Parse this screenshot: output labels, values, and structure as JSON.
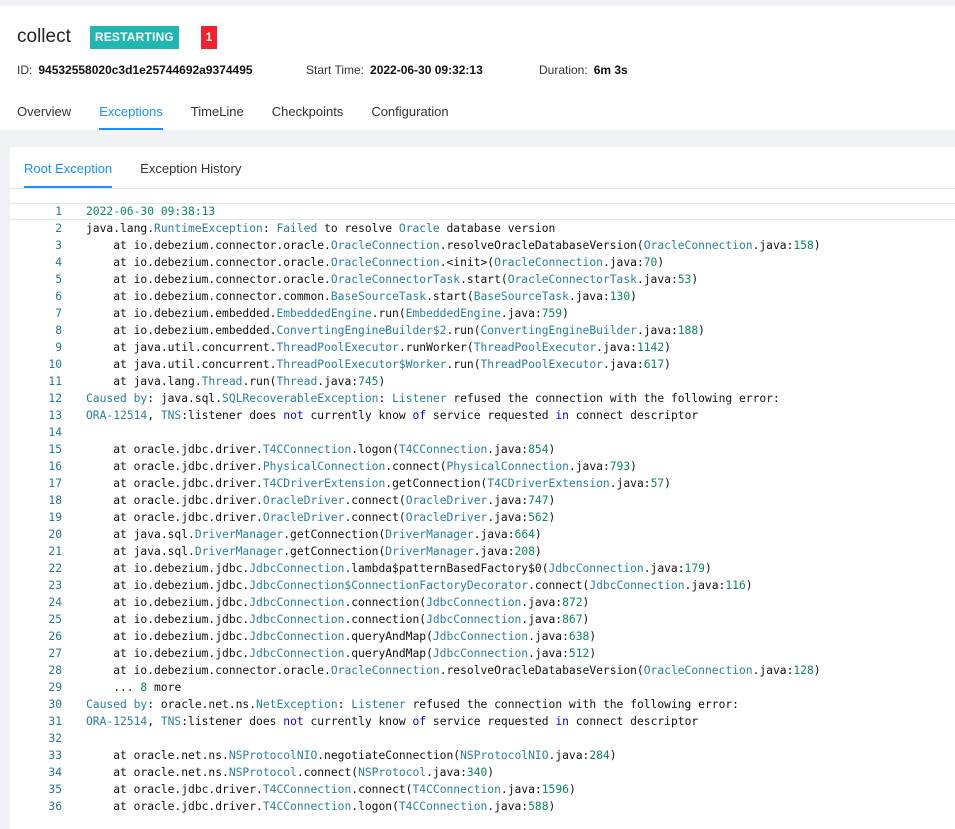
{
  "job": {
    "name": "collect",
    "status": "RESTARTING",
    "exception_count": "1",
    "id_label": "ID:",
    "id_value": "94532558020c3d1e25744692a9374495",
    "start_label": "Start Time:",
    "start_value": "2022-06-30 09:32:13",
    "duration_label": "Duration:",
    "duration_value": "6m 3s"
  },
  "tabs": [
    "Overview",
    "Exceptions",
    "TimeLine",
    "Checkpoints",
    "Configuration"
  ],
  "active_tab": "Exceptions",
  "subtabs": [
    "Root Exception",
    "Exception History"
  ],
  "active_subtab": "Root Exception",
  "colors": {
    "accent": "#1890ff",
    "status_badge": "#1fb7b2",
    "count_badge": "#f5222d",
    "line_number": "#237893",
    "class_token": "#2a7f9e",
    "number_token": "#09885a",
    "keyword_token": "#0000ff"
  },
  "code_lines": [
    [
      [
        "d",
        "2022-06-30 09:38:13"
      ]
    ],
    [
      [
        "p",
        "java.lang."
      ],
      [
        "k",
        "RuntimeException"
      ],
      [
        "p",
        ": "
      ],
      [
        "k",
        "Failed"
      ],
      [
        "p",
        " to resolve "
      ],
      [
        "k",
        "Oracle"
      ],
      [
        "p",
        " database version"
      ]
    ],
    [
      [
        "p",
        "    at io.debezium.connector.oracle."
      ],
      [
        "k",
        "OracleConnection"
      ],
      [
        "p",
        ".resolveOracleDatabaseVersion("
      ],
      [
        "k",
        "OracleConnection"
      ],
      [
        "p",
        ".java:"
      ],
      [
        "n",
        "158"
      ],
      [
        "p",
        ")"
      ]
    ],
    [
      [
        "p",
        "    at io.debezium.connector.oracle."
      ],
      [
        "k",
        "OracleConnection"
      ],
      [
        "p",
        ".<init>("
      ],
      [
        "k",
        "OracleConnection"
      ],
      [
        "p",
        ".java:"
      ],
      [
        "n",
        "70"
      ],
      [
        "p",
        ")"
      ]
    ],
    [
      [
        "p",
        "    at io.debezium.connector.oracle."
      ],
      [
        "k",
        "OracleConnectorTask"
      ],
      [
        "p",
        ".start("
      ],
      [
        "k",
        "OracleConnectorTask"
      ],
      [
        "p",
        ".java:"
      ],
      [
        "n",
        "53"
      ],
      [
        "p",
        ")"
      ]
    ],
    [
      [
        "p",
        "    at io.debezium.connector.common."
      ],
      [
        "k",
        "BaseSourceTask"
      ],
      [
        "p",
        ".start("
      ],
      [
        "k",
        "BaseSourceTask"
      ],
      [
        "p",
        ".java:"
      ],
      [
        "n",
        "130"
      ],
      [
        "p",
        ")"
      ]
    ],
    [
      [
        "p",
        "    at io.debezium.embedded."
      ],
      [
        "k",
        "EmbeddedEngine"
      ],
      [
        "p",
        ".run("
      ],
      [
        "k",
        "EmbeddedEngine"
      ],
      [
        "p",
        ".java:"
      ],
      [
        "n",
        "759"
      ],
      [
        "p",
        ")"
      ]
    ],
    [
      [
        "p",
        "    at io.debezium.embedded."
      ],
      [
        "k",
        "ConvertingEngineBuilder$2"
      ],
      [
        "p",
        ".run("
      ],
      [
        "k",
        "ConvertingEngineBuilder"
      ],
      [
        "p",
        ".java:"
      ],
      [
        "n",
        "188"
      ],
      [
        "p",
        ")"
      ]
    ],
    [
      [
        "p",
        "    at java.util.concurrent."
      ],
      [
        "k",
        "ThreadPoolExecutor"
      ],
      [
        "p",
        ".runWorker("
      ],
      [
        "k",
        "ThreadPoolExecutor"
      ],
      [
        "p",
        ".java:"
      ],
      [
        "n",
        "1142"
      ],
      [
        "p",
        ")"
      ]
    ],
    [
      [
        "p",
        "    at java.util.concurrent."
      ],
      [
        "k",
        "ThreadPoolExecutor$Worker"
      ],
      [
        "p",
        ".run("
      ],
      [
        "k",
        "ThreadPoolExecutor"
      ],
      [
        "p",
        ".java:"
      ],
      [
        "n",
        "617"
      ],
      [
        "p",
        ")"
      ]
    ],
    [
      [
        "p",
        "    at java.lang."
      ],
      [
        "k",
        "Thread"
      ],
      [
        "p",
        ".run("
      ],
      [
        "k",
        "Thread"
      ],
      [
        "p",
        ".java:"
      ],
      [
        "n",
        "745"
      ],
      [
        "p",
        ")"
      ]
    ],
    [
      [
        "k",
        "Caused by"
      ],
      [
        "p",
        ": java.sql."
      ],
      [
        "k",
        "SQLRecoverableException"
      ],
      [
        "p",
        ": "
      ],
      [
        "k",
        "Listener"
      ],
      [
        "p",
        " refused the connection with the following error:"
      ]
    ],
    [
      [
        "k",
        "ORA-12514"
      ],
      [
        "p",
        ", "
      ],
      [
        "k",
        "TNS"
      ],
      [
        "p",
        ":listener does "
      ],
      [
        "b",
        "not"
      ],
      [
        "p",
        " currently know "
      ],
      [
        "b",
        "of"
      ],
      [
        "p",
        " service requested "
      ],
      [
        "b",
        "in"
      ],
      [
        "p",
        " connect descriptor"
      ]
    ],
    [
      [
        "p",
        ""
      ]
    ],
    [
      [
        "p",
        "    at oracle.jdbc.driver."
      ],
      [
        "k",
        "T4CConnection"
      ],
      [
        "p",
        ".logon("
      ],
      [
        "k",
        "T4CConnection"
      ],
      [
        "p",
        ".java:"
      ],
      [
        "n",
        "854"
      ],
      [
        "p",
        ")"
      ]
    ],
    [
      [
        "p",
        "    at oracle.jdbc.driver."
      ],
      [
        "k",
        "PhysicalConnection"
      ],
      [
        "p",
        ".connect("
      ],
      [
        "k",
        "PhysicalConnection"
      ],
      [
        "p",
        ".java:"
      ],
      [
        "n",
        "793"
      ],
      [
        "p",
        ")"
      ]
    ],
    [
      [
        "p",
        "    at oracle.jdbc.driver."
      ],
      [
        "k",
        "T4CDriverExtension"
      ],
      [
        "p",
        ".getConnection("
      ],
      [
        "k",
        "T4CDriverExtension"
      ],
      [
        "p",
        ".java:"
      ],
      [
        "n",
        "57"
      ],
      [
        "p",
        ")"
      ]
    ],
    [
      [
        "p",
        "    at oracle.jdbc.driver."
      ],
      [
        "k",
        "OracleDriver"
      ],
      [
        "p",
        ".connect("
      ],
      [
        "k",
        "OracleDriver"
      ],
      [
        "p",
        ".java:"
      ],
      [
        "n",
        "747"
      ],
      [
        "p",
        ")"
      ]
    ],
    [
      [
        "p",
        "    at oracle.jdbc.driver."
      ],
      [
        "k",
        "OracleDriver"
      ],
      [
        "p",
        ".connect("
      ],
      [
        "k",
        "OracleDriver"
      ],
      [
        "p",
        ".java:"
      ],
      [
        "n",
        "562"
      ],
      [
        "p",
        ")"
      ]
    ],
    [
      [
        "p",
        "    at java.sql."
      ],
      [
        "k",
        "DriverManager"
      ],
      [
        "p",
        ".getConnection("
      ],
      [
        "k",
        "DriverManager"
      ],
      [
        "p",
        ".java:"
      ],
      [
        "n",
        "664"
      ],
      [
        "p",
        ")"
      ]
    ],
    [
      [
        "p",
        "    at java.sql."
      ],
      [
        "k",
        "DriverManager"
      ],
      [
        "p",
        ".getConnection("
      ],
      [
        "k",
        "DriverManager"
      ],
      [
        "p",
        ".java:"
      ],
      [
        "n",
        "208"
      ],
      [
        "p",
        ")"
      ]
    ],
    [
      [
        "p",
        "    at io.debezium.jdbc."
      ],
      [
        "k",
        "JdbcConnection"
      ],
      [
        "p",
        ".lambda$patternBasedFactory$0("
      ],
      [
        "k",
        "JdbcConnection"
      ],
      [
        "p",
        ".java:"
      ],
      [
        "n",
        "179"
      ],
      [
        "p",
        ")"
      ]
    ],
    [
      [
        "p",
        "    at io.debezium.jdbc."
      ],
      [
        "k",
        "JdbcConnection$ConnectionFactoryDecorator"
      ],
      [
        "p",
        ".connect("
      ],
      [
        "k",
        "JdbcConnection"
      ],
      [
        "p",
        ".java:"
      ],
      [
        "n",
        "116"
      ],
      [
        "p",
        ")"
      ]
    ],
    [
      [
        "p",
        "    at io.debezium.jdbc."
      ],
      [
        "k",
        "JdbcConnection"
      ],
      [
        "p",
        ".connection("
      ],
      [
        "k",
        "JdbcConnection"
      ],
      [
        "p",
        ".java:"
      ],
      [
        "n",
        "872"
      ],
      [
        "p",
        ")"
      ]
    ],
    [
      [
        "p",
        "    at io.debezium.jdbc."
      ],
      [
        "k",
        "JdbcConnection"
      ],
      [
        "p",
        ".connection("
      ],
      [
        "k",
        "JdbcConnection"
      ],
      [
        "p",
        ".java:"
      ],
      [
        "n",
        "867"
      ],
      [
        "p",
        ")"
      ]
    ],
    [
      [
        "p",
        "    at io.debezium.jdbc."
      ],
      [
        "k",
        "JdbcConnection"
      ],
      [
        "p",
        ".queryAndMap("
      ],
      [
        "k",
        "JdbcConnection"
      ],
      [
        "p",
        ".java:"
      ],
      [
        "n",
        "638"
      ],
      [
        "p",
        ")"
      ]
    ],
    [
      [
        "p",
        "    at io.debezium.jdbc."
      ],
      [
        "k",
        "JdbcConnection"
      ],
      [
        "p",
        ".queryAndMap("
      ],
      [
        "k",
        "JdbcConnection"
      ],
      [
        "p",
        ".java:"
      ],
      [
        "n",
        "512"
      ],
      [
        "p",
        ")"
      ]
    ],
    [
      [
        "p",
        "    at io.debezium.connector.oracle."
      ],
      [
        "k",
        "OracleConnection"
      ],
      [
        "p",
        ".resolveOracleDatabaseVersion("
      ],
      [
        "k",
        "OracleConnection"
      ],
      [
        "p",
        ".java:"
      ],
      [
        "n",
        "128"
      ],
      [
        "p",
        ")"
      ]
    ],
    [
      [
        "p",
        "    ... "
      ],
      [
        "n",
        "8"
      ],
      [
        "p",
        " more"
      ]
    ],
    [
      [
        "k",
        "Caused by"
      ],
      [
        "p",
        ": oracle.net.ns."
      ],
      [
        "k",
        "NetException"
      ],
      [
        "p",
        ": "
      ],
      [
        "k",
        "Listener"
      ],
      [
        "p",
        " refused the connection with the following error:"
      ]
    ],
    [
      [
        "k",
        "ORA-12514"
      ],
      [
        "p",
        ", "
      ],
      [
        "k",
        "TNS"
      ],
      [
        "p",
        ":listener does "
      ],
      [
        "b",
        "not"
      ],
      [
        "p",
        " currently know "
      ],
      [
        "b",
        "of"
      ],
      [
        "p",
        " service requested "
      ],
      [
        "b",
        "in"
      ],
      [
        "p",
        " connect descriptor"
      ]
    ],
    [
      [
        "p",
        ""
      ]
    ],
    [
      [
        "p",
        "    at oracle.net.ns."
      ],
      [
        "k",
        "NSProtocolNIO"
      ],
      [
        "p",
        ".negotiateConnection("
      ],
      [
        "k",
        "NSProtocolNIO"
      ],
      [
        "p",
        ".java:"
      ],
      [
        "n",
        "284"
      ],
      [
        "p",
        ")"
      ]
    ],
    [
      [
        "p",
        "    at oracle.net.ns."
      ],
      [
        "k",
        "NSProtocol"
      ],
      [
        "p",
        ".connect("
      ],
      [
        "k",
        "NSProtocol"
      ],
      [
        "p",
        ".java:"
      ],
      [
        "n",
        "340"
      ],
      [
        "p",
        ")"
      ]
    ],
    [
      [
        "p",
        "    at oracle.jdbc.driver."
      ],
      [
        "k",
        "T4CConnection"
      ],
      [
        "p",
        ".connect("
      ],
      [
        "k",
        "T4CConnection"
      ],
      [
        "p",
        ".java:"
      ],
      [
        "n",
        "1596"
      ],
      [
        "p",
        ")"
      ]
    ],
    [
      [
        "p",
        "    at oracle.jdbc.driver."
      ],
      [
        "k",
        "T4CConnection"
      ],
      [
        "p",
        ".logon("
      ],
      [
        "k",
        "T4CConnection"
      ],
      [
        "p",
        ".java:"
      ],
      [
        "n",
        "588"
      ],
      [
        "p",
        ")"
      ]
    ]
  ]
}
